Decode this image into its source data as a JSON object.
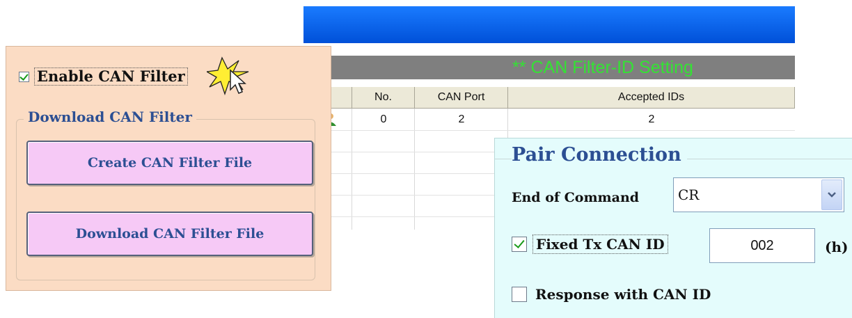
{
  "filter_panel": {
    "enable_label": "Enable CAN Filter",
    "enable_checked": true,
    "group_title": "Download CAN Filter",
    "create_button": "Create CAN Filter File",
    "download_button": "Download CAN Filter File"
  },
  "filter_table": {
    "title": "** CAN Filter-ID Setting",
    "columns": [
      "",
      "No.",
      "CAN Port",
      "Accepted IDs"
    ],
    "rows": [
      {
        "icon": "row-edit-icon",
        "no": "0",
        "can_port": "2",
        "accepted_ids": "2"
      }
    ]
  },
  "pair_connection": {
    "title": "Pair Connection",
    "end_of_command_label": "End of Command",
    "end_of_command_value": "CR",
    "fixed_tx_label": "Fixed Tx CAN ID",
    "fixed_tx_checked": true,
    "fixed_tx_value": "002",
    "hex_unit": "(h)",
    "response_label": "Response with CAN ID",
    "response_checked": false
  },
  "colors": {
    "title_bar_blue": "#0060f0",
    "filter_title_green": "#34e234",
    "button_pink": "#f6c9f6",
    "left_panel_bg": "#fbdcc4",
    "right_panel_bg": "#e4fcfc",
    "group_text_blue": "#2c4f93"
  }
}
